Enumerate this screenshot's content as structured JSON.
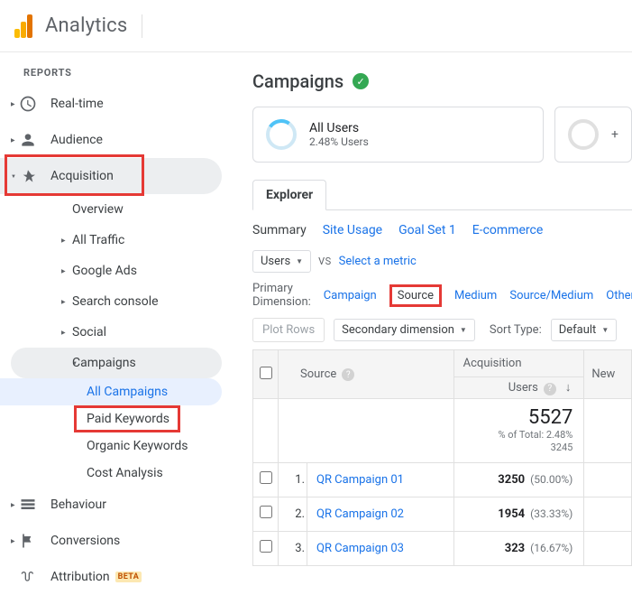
{
  "header": {
    "title": "Analytics"
  },
  "sidebar": {
    "section": "REPORTS",
    "items": {
      "realtime": "Real-time",
      "audience": "Audience",
      "acquisition": "Acquisition",
      "behaviour": "Behaviour",
      "conversions": "Conversions",
      "attribution": "Attribution",
      "attribution_badge": "BETA"
    },
    "acq_sub": {
      "overview": "Overview",
      "all_traffic": "All Traffic",
      "google_ads": "Google Ads",
      "search_console": "Search console",
      "social": "Social",
      "campaigns": "Campaigns"
    },
    "camp_sub": {
      "all": "All Campaigns",
      "paid": "Paid Keywords",
      "organic": "Organic Keywords",
      "cost": "Cost Analysis"
    }
  },
  "page": {
    "title": "Campaigns",
    "segment": {
      "title": "All Users",
      "sub": "2.48% Users"
    },
    "tab": "Explorer",
    "subtabs": {
      "summary": "Summary",
      "site": "Site Usage",
      "goal": "Goal Set 1",
      "ecom": "E-commerce"
    },
    "controls": {
      "users": "Users",
      "vs": "VS",
      "select_metric": "Select a metric"
    },
    "dim": {
      "label": "Primary Dimension:",
      "campaign": "Campaign",
      "source": "Source",
      "medium": "Medium",
      "sm": "Source/Medium",
      "other": "Other"
    },
    "filter": {
      "plot": "Plot Rows",
      "secondary": "Secondary dimension",
      "sort": "Sort Type:",
      "default": "Default"
    },
    "table": {
      "src_header": "Source",
      "acq_header": "Acquisition",
      "users_header": "Users",
      "new_header": "New",
      "total": "5527",
      "total_sub1": "% of Total: 2.48%",
      "total_sub2": "3245",
      "rows": [
        {
          "rank": "1.",
          "name": "QR Campaign 01",
          "users": "3250",
          "pct": "(50.00%)"
        },
        {
          "rank": "2.",
          "name": "QR Campaign 02",
          "users": "1954",
          "pct": "(33.33%)"
        },
        {
          "rank": "3.",
          "name": "QR Campaign 03",
          "users": "323",
          "pct": "(16.67%)"
        }
      ]
    }
  }
}
